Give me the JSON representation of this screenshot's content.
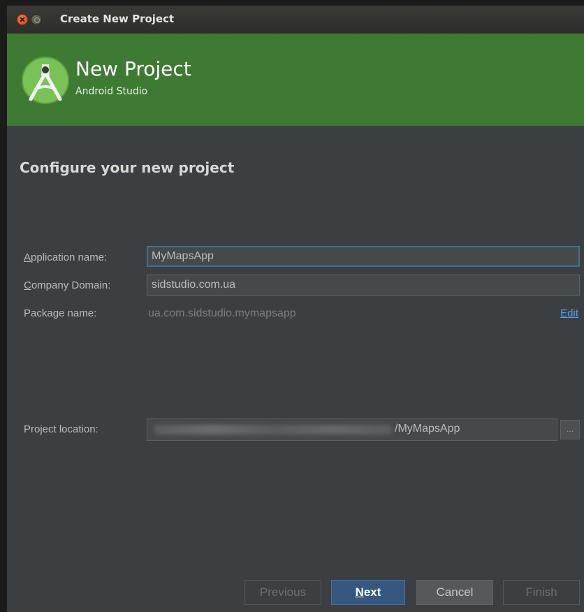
{
  "window": {
    "title": "Create New Project"
  },
  "header": {
    "title": "New Project",
    "subtitle": "Android Studio",
    "background_color": "#3f7a34",
    "logo_icon": "android-studio-logo-icon"
  },
  "form": {
    "heading": "Configure your new project",
    "application_name": {
      "label_first": "A",
      "label_rest": "pplication name:",
      "value": "MyMapsApp"
    },
    "company_domain": {
      "label_first": "C",
      "label_rest": "ompany Domain:",
      "value": "sidstudio.com.ua"
    },
    "package_name": {
      "label": "Package name:",
      "value": "ua.com.sidstudio.mymapsapp",
      "edit_link": "Edit"
    },
    "project_location": {
      "label": "Project location:",
      "value_suffix": "/MyMapsApp",
      "browse_label": "..."
    }
  },
  "buttons": {
    "previous": "Previous",
    "next_first": "N",
    "next_rest": "ext",
    "cancel": "Cancel",
    "finish": "Finish"
  },
  "colors": {
    "accent_focus": "#466d94",
    "primary_button": "#365880",
    "link": "#589df6"
  }
}
